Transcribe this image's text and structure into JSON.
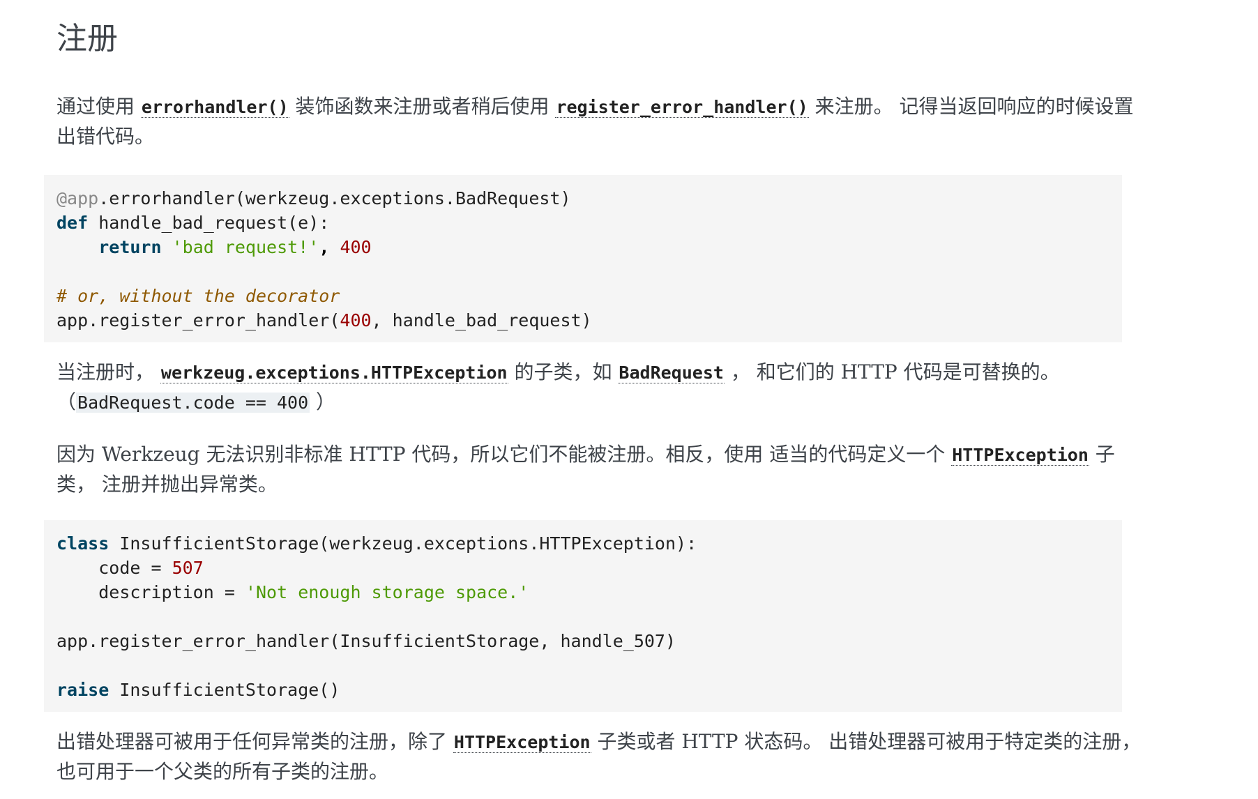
{
  "heading": "注册",
  "para1": {
    "t1": "通过使用 ",
    "c1": "errorhandler()",
    "t2": " 装饰函数来注册或者稍后使用 ",
    "c2": "register_error_handler()",
    "t3": " 来注册。 记得当返回响应的时候设置出错代码。"
  },
  "code1": {
    "l1": {
      "dec": "@app",
      "rest": ".errorhandler(werkzeug.exceptions.BadRequest)"
    },
    "l2": {
      "kw": "def",
      "rest": " handle_bad_request(e):"
    },
    "l3": {
      "indent": "    ",
      "kw": "return",
      "sp": " ",
      "str": "'bad request!'",
      "comma": ",",
      "sp2": " ",
      "num": "400"
    },
    "l5": {
      "comment": "# or, without the decorator"
    },
    "l6": {
      "pre": "app.register_error_handler(",
      "num": "400",
      "post": ", handle_bad_request)"
    }
  },
  "para2": {
    "t1": "当注册时， ",
    "c1": "werkzeug.exceptions.HTTPException",
    "t2": " 的子类，如 ",
    "c2": "BadRequest",
    "t3": " ， 和它们的 HTTP 代码是可替换的。 （",
    "c3": "BadRequest.code == 400",
    "t4": " ）"
  },
  "para3": {
    "t1": "因为 Werkzeug 无法识别非标准 HTTP 代码，所以它们不能被注册。相反，使用 适当的代码定义一个 ",
    "c1": "HTTPException",
    "t2": " 子类， 注册并抛出异常类。"
  },
  "code2": {
    "l1": {
      "kw": "class",
      "rest": " InsufficientStorage(werkzeug.exceptions.HTTPException):"
    },
    "l2": {
      "indent": "    ",
      "name": "code",
      "eq": " = ",
      "num": "507"
    },
    "l3": {
      "indent": "    ",
      "name": "description",
      "eq": " = ",
      "str": "'Not enough storage space.'"
    },
    "l5": {
      "text": "app.register_error_handler(InsufficientStorage, handle_507)"
    },
    "l7": {
      "kw": "raise",
      "rest": " InsufficientStorage()"
    }
  },
  "para4": {
    "t1": "出错处理器可被用于任何异常类的注册，除了 ",
    "c1": "HTTPException",
    "t2": " 子类或者 HTTP 状态码。 出错处理器可被用于特定类的注册，也可用于一个父类的所有子类的注册。"
  }
}
